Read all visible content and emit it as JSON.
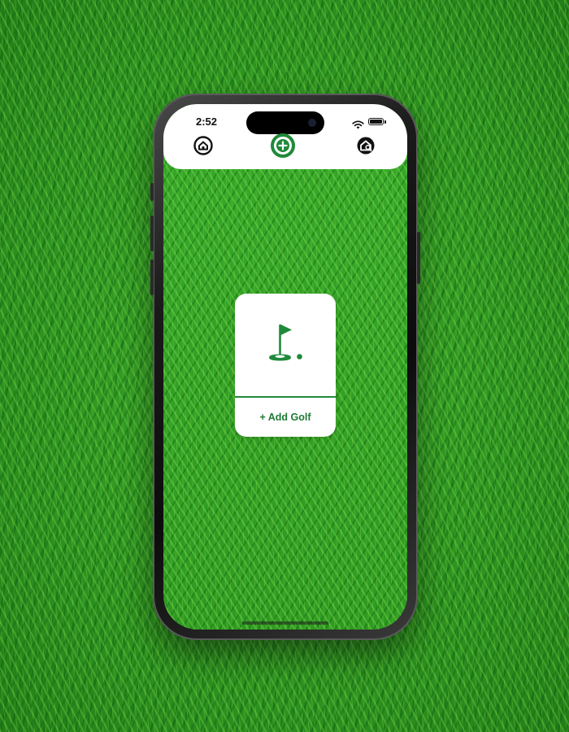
{
  "status_bar": {
    "time": "2:52"
  },
  "nav": {
    "home_icon": "home-icon",
    "add_icon": "plus-circle-icon",
    "search_icon": "map-search-icon"
  },
  "card": {
    "icon": "golf-flag-icon",
    "label": "+ Add Golf"
  },
  "colors": {
    "accent_green": "#1f8a3a",
    "label_green": "#1f7a35",
    "background_grass": "#2f9a23",
    "card_background": "#ffffff"
  }
}
